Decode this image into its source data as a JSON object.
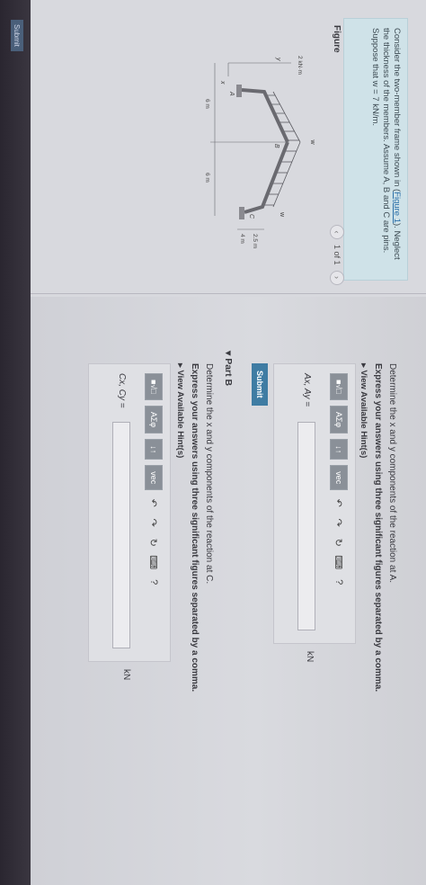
{
  "problem": {
    "text_prefix": "Consider the two-member frame shown in (",
    "figure_link": "Figure 1",
    "text_suffix": "). Neglect the thickness of the members. Assume A, B and C are pins. Suppose that w = 7 kN/m."
  },
  "figure_panel": {
    "heading": "Figure",
    "nav": {
      "counter": "1 of 1",
      "prev_icon": "chevron-left-icon",
      "next_icon": "chevron-right-icon"
    }
  },
  "figure_labels": {
    "load_left": "w",
    "load_right": "w",
    "moment": "2 kN·m",
    "pin_a": "A",
    "pin_b": "B",
    "pin_c": "C",
    "dim_left": "6 m",
    "dim_right": "6 m",
    "dim_height": "2.5 m",
    "dim_base": "4 m",
    "axis_y": "y",
    "axis_x": "x"
  },
  "part_a": {
    "question": "Determine the x and y components of the reaction at A.",
    "instruction": "Express your answers using three significant figures separated by a comma.",
    "hints_label": "View Available Hint(s)",
    "toolbar": {
      "templates": "■√□",
      "greek": "AΣφ",
      "arrows": "↓↑",
      "vec": "vec",
      "undo": "↶",
      "redo": "↷",
      "reset": "↻",
      "keyboard": "⌨",
      "help": "?"
    },
    "input_label": "Ax, Ay =",
    "input_value": "",
    "unit": "kN",
    "submit": "Submit"
  },
  "part_b": {
    "header": "Part B",
    "question": "Determine the x and y components of the reaction at C.",
    "instruction": "Express your answers using three significant figures separated by a comma.",
    "hints_label": "View Available Hint(s)",
    "toolbar": {
      "templates": "■√□",
      "greek": "AΣφ",
      "arrows": "↓↑",
      "vec": "vec",
      "undo": "↶",
      "redo": "↷",
      "reset": "↻",
      "keyboard": "⌨",
      "help": "?"
    },
    "input_label": "Cx, Cy =",
    "input_value": "",
    "unit": "kN",
    "submit": "Submit"
  },
  "colors": {
    "accent": "#3f7ca3",
    "problem_bg": "#cfe2e8",
    "toolbar_btn": "#8a9098"
  }
}
